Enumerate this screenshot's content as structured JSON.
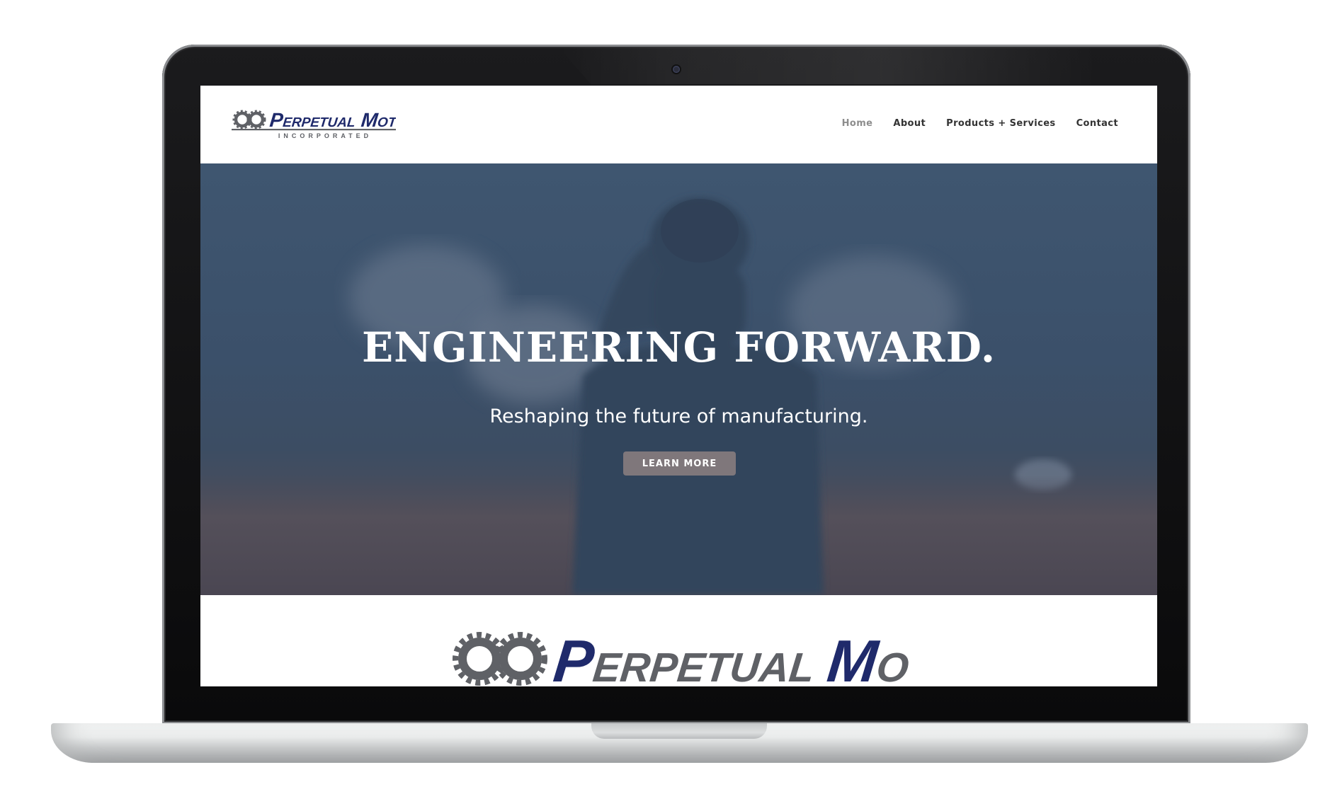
{
  "brand": {
    "name_word1_initial": "P",
    "name_word1_rest": "ERPETUAL",
    "name_word2_initial": "M",
    "name_word2_rest": "OTION",
    "tagline": "INCORPORATED",
    "logo_icon": "infinity-gear-icon",
    "colors": {
      "navy": "#1f2a6b",
      "gray": "#5f6166"
    }
  },
  "nav": {
    "items": [
      {
        "label": "Home",
        "active": true
      },
      {
        "label": "About",
        "active": false
      },
      {
        "label": "Products + Services",
        "active": false
      },
      {
        "label": "Contact",
        "active": false
      }
    ]
  },
  "hero": {
    "title": "ENGINEERING FORWARD.",
    "subtitle": "Reshaping the future of manufacturing.",
    "cta_label": "LEARN MORE",
    "overlay_color": "#3f5670"
  }
}
